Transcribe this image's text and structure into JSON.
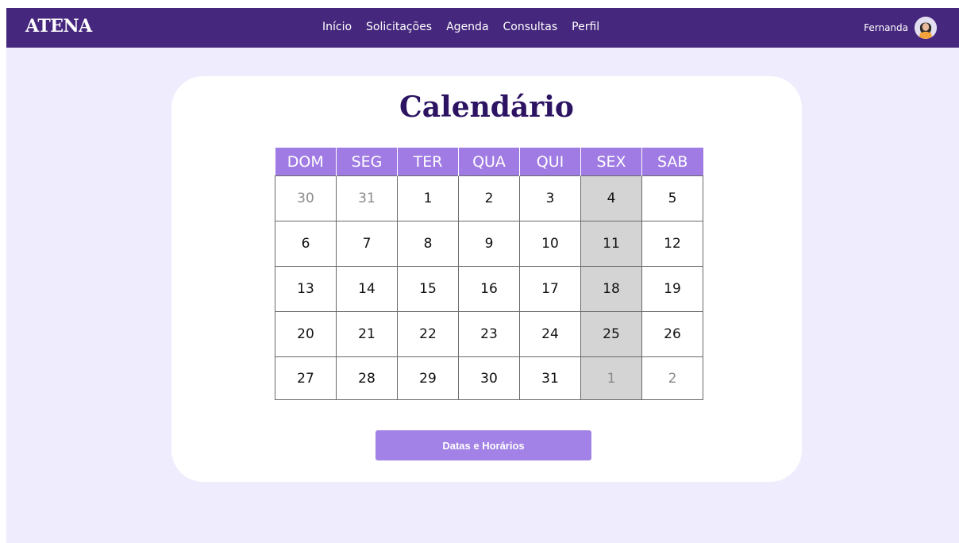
{
  "brand": "ATENA",
  "nav": {
    "items": [
      "Início",
      "Solicitações",
      "Agenda",
      "Consultas",
      "Perfil"
    ]
  },
  "user": {
    "name": "Fernanda"
  },
  "page": {
    "title": "Calendário",
    "button_label": "Datas e Horários"
  },
  "calendar": {
    "headers": [
      "DOM",
      "SEG",
      "TER",
      "QUA",
      "QUI",
      "SEX",
      "SAB"
    ],
    "weeks": [
      [
        "30",
        "31",
        "1",
        "2",
        "3",
        "4",
        "5"
      ],
      [
        "6",
        "7",
        "8",
        "9",
        "10",
        "11",
        "12"
      ],
      [
        "13",
        "14",
        "15",
        "16",
        "17",
        "18",
        "19"
      ],
      [
        "20",
        "21",
        "22",
        "23",
        "24",
        "25",
        "26"
      ],
      [
        "27",
        "28",
        "29",
        "30",
        "31",
        "1",
        "2"
      ]
    ]
  },
  "colors": {
    "navbar": "#45277d",
    "background": "#efecfd",
    "header_cells": "#a07be4",
    "highlight_column": "#d4d4d4",
    "button": "#a282e6",
    "title": "#2c1463"
  },
  "icons": {
    "avatar": "user-avatar-icon"
  }
}
